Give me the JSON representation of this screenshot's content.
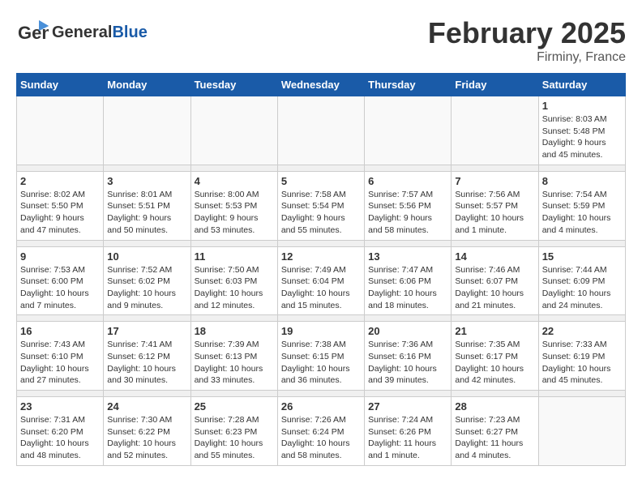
{
  "header": {
    "logo_general": "General",
    "logo_blue": "Blue",
    "month_title": "February 2025",
    "location": "Firminy, France"
  },
  "weekdays": [
    "Sunday",
    "Monday",
    "Tuesday",
    "Wednesday",
    "Thursday",
    "Friday",
    "Saturday"
  ],
  "weeks": [
    [
      {
        "day": "",
        "info": ""
      },
      {
        "day": "",
        "info": ""
      },
      {
        "day": "",
        "info": ""
      },
      {
        "day": "",
        "info": ""
      },
      {
        "day": "",
        "info": ""
      },
      {
        "day": "",
        "info": ""
      },
      {
        "day": "1",
        "info": "Sunrise: 8:03 AM\nSunset: 5:48 PM\nDaylight: 9 hours and 45 minutes."
      }
    ],
    [
      {
        "day": "2",
        "info": "Sunrise: 8:02 AM\nSunset: 5:50 PM\nDaylight: 9 hours and 47 minutes."
      },
      {
        "day": "3",
        "info": "Sunrise: 8:01 AM\nSunset: 5:51 PM\nDaylight: 9 hours and 50 minutes."
      },
      {
        "day": "4",
        "info": "Sunrise: 8:00 AM\nSunset: 5:53 PM\nDaylight: 9 hours and 53 minutes."
      },
      {
        "day": "5",
        "info": "Sunrise: 7:58 AM\nSunset: 5:54 PM\nDaylight: 9 hours and 55 minutes."
      },
      {
        "day": "6",
        "info": "Sunrise: 7:57 AM\nSunset: 5:56 PM\nDaylight: 9 hours and 58 minutes."
      },
      {
        "day": "7",
        "info": "Sunrise: 7:56 AM\nSunset: 5:57 PM\nDaylight: 10 hours and 1 minute."
      },
      {
        "day": "8",
        "info": "Sunrise: 7:54 AM\nSunset: 5:59 PM\nDaylight: 10 hours and 4 minutes."
      }
    ],
    [
      {
        "day": "9",
        "info": "Sunrise: 7:53 AM\nSunset: 6:00 PM\nDaylight: 10 hours and 7 minutes."
      },
      {
        "day": "10",
        "info": "Sunrise: 7:52 AM\nSunset: 6:02 PM\nDaylight: 10 hours and 9 minutes."
      },
      {
        "day": "11",
        "info": "Sunrise: 7:50 AM\nSunset: 6:03 PM\nDaylight: 10 hours and 12 minutes."
      },
      {
        "day": "12",
        "info": "Sunrise: 7:49 AM\nSunset: 6:04 PM\nDaylight: 10 hours and 15 minutes."
      },
      {
        "day": "13",
        "info": "Sunrise: 7:47 AM\nSunset: 6:06 PM\nDaylight: 10 hours and 18 minutes."
      },
      {
        "day": "14",
        "info": "Sunrise: 7:46 AM\nSunset: 6:07 PM\nDaylight: 10 hours and 21 minutes."
      },
      {
        "day": "15",
        "info": "Sunrise: 7:44 AM\nSunset: 6:09 PM\nDaylight: 10 hours and 24 minutes."
      }
    ],
    [
      {
        "day": "16",
        "info": "Sunrise: 7:43 AM\nSunset: 6:10 PM\nDaylight: 10 hours and 27 minutes."
      },
      {
        "day": "17",
        "info": "Sunrise: 7:41 AM\nSunset: 6:12 PM\nDaylight: 10 hours and 30 minutes."
      },
      {
        "day": "18",
        "info": "Sunrise: 7:39 AM\nSunset: 6:13 PM\nDaylight: 10 hours and 33 minutes."
      },
      {
        "day": "19",
        "info": "Sunrise: 7:38 AM\nSunset: 6:15 PM\nDaylight: 10 hours and 36 minutes."
      },
      {
        "day": "20",
        "info": "Sunrise: 7:36 AM\nSunset: 6:16 PM\nDaylight: 10 hours and 39 minutes."
      },
      {
        "day": "21",
        "info": "Sunrise: 7:35 AM\nSunset: 6:17 PM\nDaylight: 10 hours and 42 minutes."
      },
      {
        "day": "22",
        "info": "Sunrise: 7:33 AM\nSunset: 6:19 PM\nDaylight: 10 hours and 45 minutes."
      }
    ],
    [
      {
        "day": "23",
        "info": "Sunrise: 7:31 AM\nSunset: 6:20 PM\nDaylight: 10 hours and 48 minutes."
      },
      {
        "day": "24",
        "info": "Sunrise: 7:30 AM\nSunset: 6:22 PM\nDaylight: 10 hours and 52 minutes."
      },
      {
        "day": "25",
        "info": "Sunrise: 7:28 AM\nSunset: 6:23 PM\nDaylight: 10 hours and 55 minutes."
      },
      {
        "day": "26",
        "info": "Sunrise: 7:26 AM\nSunset: 6:24 PM\nDaylight: 10 hours and 58 minutes."
      },
      {
        "day": "27",
        "info": "Sunrise: 7:24 AM\nSunset: 6:26 PM\nDaylight: 11 hours and 1 minute."
      },
      {
        "day": "28",
        "info": "Sunrise: 7:23 AM\nSunset: 6:27 PM\nDaylight: 11 hours and 4 minutes."
      },
      {
        "day": "",
        "info": ""
      }
    ]
  ]
}
